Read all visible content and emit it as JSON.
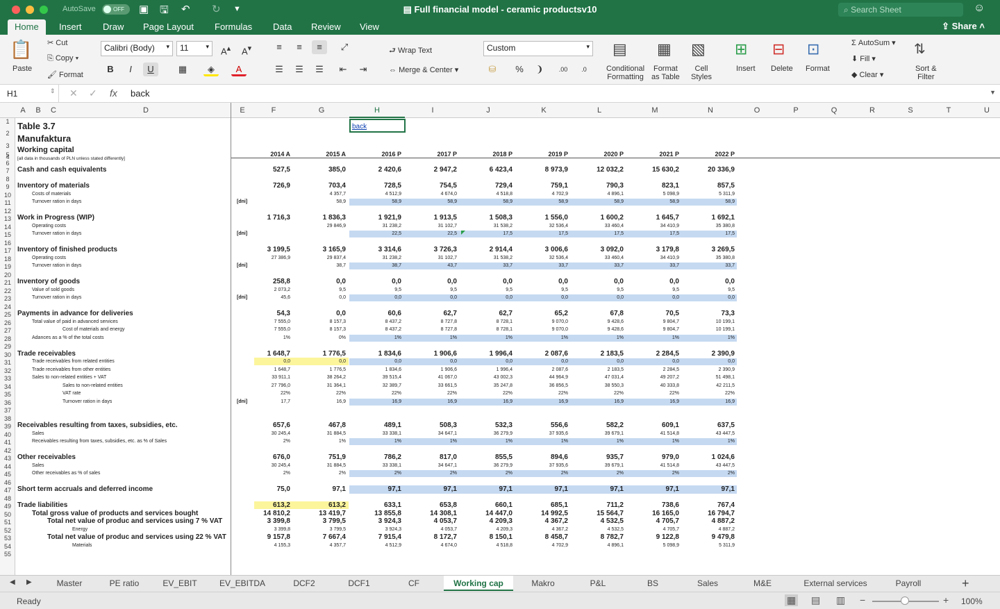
{
  "window": {
    "autosave": "AutoSave",
    "autosave_state": "OFF",
    "title": "Full financial model - ceramic productsv10",
    "search_placeholder": "Search Sheet",
    "share": "Share"
  },
  "ribbon_tabs": [
    "Home",
    "Insert",
    "Draw",
    "Page Layout",
    "Formulas",
    "Data",
    "Review",
    "View"
  ],
  "ribbon": {
    "paste": "Paste",
    "cut": "Cut",
    "copy": "Copy",
    "format_painter": "Format",
    "font_name": "Calibri (Body)",
    "font_size": "11",
    "wrap_text": "Wrap Text",
    "merge_center": "Merge & Center",
    "number_format": "Custom",
    "conditional_formatting": "Conditional\nFormatting",
    "format_as_table": "Format\nas Table",
    "cell_styles": "Cell\nStyles",
    "insert": "Insert",
    "delete": "Delete",
    "format": "Format",
    "autosum": "AutoSum",
    "fill": "Fill",
    "clear": "Clear",
    "sort_filter": "Sort &\nFilter"
  },
  "formula": {
    "cell_ref": "H1",
    "content": "back"
  },
  "columns": [
    "A",
    "B",
    "C",
    "D",
    "E",
    "F",
    "G",
    "H",
    "I",
    "J",
    "K",
    "L",
    "M",
    "N",
    "O",
    "P",
    "Q",
    "R",
    "S",
    "T",
    "U"
  ],
  "sheet": {
    "title": "Table 3.7",
    "company": "Manufaktura",
    "subtitle": "Working capital",
    "note": "[all data in thousands of PLN unless stated differently]",
    "back_link": "back",
    "years": [
      "2014 A",
      "2015 A",
      "2016 P",
      "2017 P",
      "2018 P",
      "2019 P",
      "2020 P",
      "2021 P",
      "2022 P"
    ],
    "rows": [
      {
        "r": 7,
        "label": "Cash and cash equivalents",
        "bold": true,
        "v": [
          "527,5",
          "385,0",
          "2 420,6",
          "2 947,2",
          "6 423,4",
          "8 973,9",
          "12 032,2",
          "15 630,2",
          "20 336,9"
        ]
      },
      {
        "r": 9,
        "label": "Inventory of materials",
        "bold": true,
        "v": [
          "726,9",
          "703,4",
          "728,5",
          "754,5",
          "729,4",
          "759,1",
          "790,3",
          "823,1",
          "857,5"
        ]
      },
      {
        "r": 10,
        "label": "Costs of materials",
        "indent": 1,
        "v": [
          "",
          "4 357,7",
          "4 512,9",
          "4 674,0",
          "4 518,8",
          "4 702,9",
          "4 896,1",
          "5 098,9",
          "5 311,9"
        ]
      },
      {
        "r": 11,
        "label": "Turnover ration in days",
        "indent": 1,
        "unit": "[dni]",
        "band": true,
        "v": [
          "",
          "58,9",
          "58,9",
          "58,9",
          "58,9",
          "58,9",
          "58,9",
          "58,9",
          "58,9"
        ]
      },
      {
        "r": 13,
        "label": "Work in Progress (WIP)",
        "bold": true,
        "v": [
          "1 716,3",
          "1 836,3",
          "1 921,9",
          "1 913,5",
          "1 508,3",
          "1 556,0",
          "1 600,2",
          "1 645,7",
          "1 692,1"
        ]
      },
      {
        "r": 14,
        "label": "Operating costs",
        "indent": 1,
        "v": [
          "",
          "29 846,9",
          "31 238,2",
          "31 102,7",
          "31 538,2",
          "32 536,4",
          "33 460,4",
          "34 410,9",
          "35 380,8"
        ]
      },
      {
        "r": 15,
        "label": "Turnover ration in days",
        "indent": 1,
        "unit": "[dni]",
        "band": true,
        "v": [
          "",
          "",
          "22,5",
          "22,5",
          "17,5",
          "17,5",
          "17,5",
          "17,5",
          "17,5"
        ]
      },
      {
        "r": 17,
        "label": "Inventory of finished products",
        "bold": true,
        "v": [
          "3 199,5",
          "3 165,9",
          "3 314,6",
          "3 726,3",
          "2 914,4",
          "3 006,6",
          "3 092,0",
          "3 179,8",
          "3 269,5"
        ]
      },
      {
        "r": 18,
        "label": "Operating costs",
        "indent": 1,
        "v": [
          "27 386,9",
          "29 837,4",
          "31 238,2",
          "31 102,7",
          "31 538,2",
          "32 536,4",
          "33 460,4",
          "34 410,9",
          "35 380,8"
        ]
      },
      {
        "r": 19,
        "label": "Turnover ration in days",
        "indent": 1,
        "unit": "[dni]",
        "band": true,
        "v": [
          "",
          "38,7",
          "38,7",
          "43,7",
          "33,7",
          "33,7",
          "33,7",
          "33,7",
          "33,7"
        ]
      },
      {
        "r": 21,
        "label": "Inventory of goods",
        "bold": true,
        "v": [
          "258,8",
          "0,0",
          "0,0",
          "0,0",
          "0,0",
          "0,0",
          "0,0",
          "0,0",
          "0,0"
        ]
      },
      {
        "r": 22,
        "label": "Value of sold goods",
        "indent": 1,
        "v": [
          "2 073,2",
          "9,5",
          "9,5",
          "9,5",
          "9,5",
          "9,5",
          "9,5",
          "9,5",
          "9,5"
        ]
      },
      {
        "r": 23,
        "label": "Turnover ration in days",
        "indent": 1,
        "unit": "[dni]",
        "band": true,
        "v": [
          "45,6",
          "0,0",
          "0,0",
          "0,0",
          "0,0",
          "0,0",
          "0,0",
          "0,0",
          "0,0"
        ]
      },
      {
        "r": 25,
        "label": "Payments in advance for deliveries",
        "bold": true,
        "v": [
          "54,3",
          "0,0",
          "60,6",
          "62,7",
          "62,7",
          "65,2",
          "67,8",
          "70,5",
          "73,3"
        ]
      },
      {
        "r": 26,
        "label": "Total value of paid in advanced services",
        "indent": 1,
        "v": [
          "7 555,0",
          "8 157,3",
          "8 437,2",
          "8 727,8",
          "8 728,1",
          "9 070,0",
          "9 428,6",
          "9 804,7",
          "10 199,1"
        ]
      },
      {
        "r": 27,
        "label": "Cost of materials and energy",
        "indent": 2,
        "v": [
          "7 555,0",
          "8 157,3",
          "8 437,2",
          "8 727,8",
          "8 728,1",
          "9 070,0",
          "9 428,6",
          "9 804,7",
          "10 199,1"
        ]
      },
      {
        "r": 28,
        "label": "Adances as a % of the total costs",
        "indent": 1,
        "band": true,
        "v": [
          "1%",
          "0%",
          "1%",
          "1%",
          "1%",
          "1%",
          "1%",
          "1%",
          "1%"
        ]
      },
      {
        "r": 30,
        "label": "Trade receivables",
        "bold": true,
        "v": [
          "1 648,7",
          "1 776,5",
          "1 834,6",
          "1 906,6",
          "1 996,4",
          "2 087,6",
          "2 183,5",
          "2 284,5",
          "2 390,9"
        ]
      },
      {
        "r": 31,
        "label": "Trade receivables from related entities",
        "indent": 1,
        "band": true,
        "yellow": true,
        "v": [
          "0,0",
          "0,0",
          "0,0",
          "0,0",
          "0,0",
          "0,0",
          "0,0",
          "0,0",
          "0,0"
        ]
      },
      {
        "r": 32,
        "label": "Trade receivables from other entities",
        "indent": 1,
        "v": [
          "1 648,7",
          "1 776,5",
          "1 834,6",
          "1 906,6",
          "1 996,4",
          "2 087,6",
          "2 183,5",
          "2 284,5",
          "2 390,9"
        ]
      },
      {
        "r": 33,
        "label": "Sales to non-related entities + VAT",
        "indent": 1,
        "v": [
          "33 911,1",
          "38 264,2",
          "39 515,4",
          "41 067,0",
          "43 002,3",
          "44 964,9",
          "47 031,4",
          "49 207,2",
          "51 498,1"
        ]
      },
      {
        "r": 34,
        "label": "Sales to non-related entities",
        "indent": 2,
        "v": [
          "27 796,0",
          "31 364,1",
          "32 389,7",
          "33 661,5",
          "35 247,8",
          "36 856,5",
          "38 550,3",
          "40 333,8",
          "42 211,5"
        ]
      },
      {
        "r": 35,
        "label": "VAT rate",
        "indent": 2,
        "v": [
          "22%",
          "22%",
          "22%",
          "22%",
          "22%",
          "22%",
          "22%",
          "22%",
          "22%"
        ]
      },
      {
        "r": 36,
        "label": "Turnover ration in days",
        "indent": 2,
        "unit": "[dni]",
        "band": true,
        "v": [
          "17,7",
          "16,9",
          "16,9",
          "16,9",
          "16,9",
          "16,9",
          "16,9",
          "16,9",
          "16,9"
        ]
      },
      {
        "r": 39,
        "label": "Receivables resulting from taxes, subsidies, etc.",
        "bold": true,
        "v": [
          "657,6",
          "467,8",
          "489,1",
          "508,3",
          "532,3",
          "556,6",
          "582,2",
          "609,1",
          "637,5"
        ]
      },
      {
        "r": 40,
        "label": "Sales",
        "indent": 1,
        "v": [
          "30 245,4",
          "31 884,5",
          "33 338,1",
          "34 647,1",
          "36 279,9",
          "37 935,6",
          "39 679,1",
          "41 514,8",
          "43 447,5"
        ]
      },
      {
        "r": 41,
        "label": "Receivables resulting from taxes, subsidies, etc. as % of Sales",
        "indent": 1,
        "band": true,
        "v": [
          "2%",
          "1%",
          "1%",
          "1%",
          "1%",
          "1%",
          "1%",
          "1%",
          "1%"
        ]
      },
      {
        "r": 43,
        "label": "Other receivables",
        "bold": true,
        "v": [
          "676,0",
          "751,9",
          "786,2",
          "817,0",
          "855,5",
          "894,6",
          "935,7",
          "979,0",
          "1 024,6"
        ]
      },
      {
        "r": 44,
        "label": "Sales",
        "indent": 1,
        "v": [
          "30 245,4",
          "31 884,5",
          "33 338,1",
          "34 647,1",
          "36 279,9",
          "37 935,6",
          "39 679,1",
          "41 514,8",
          "43 447,5"
        ]
      },
      {
        "r": 45,
        "label": "Other receivables as % of sales",
        "indent": 1,
        "band": true,
        "v": [
          "2%",
          "2%",
          "2%",
          "2%",
          "2%",
          "2%",
          "2%",
          "2%",
          "2%"
        ]
      },
      {
        "r": 47,
        "label": "Short term accruals and deferred income",
        "bold": true,
        "bigband": true,
        "v": [
          "75,0",
          "97,1",
          "97,1",
          "97,1",
          "97,1",
          "97,1",
          "97,1",
          "97,1",
          "97,1"
        ]
      },
      {
        "r": 49,
        "label": "Trade liabilities",
        "bold": true,
        "yellow": true,
        "v": [
          "613,2",
          "613,2",
          "633,1",
          "653,8",
          "660,1",
          "685,1",
          "711,2",
          "738,6",
          "767,4"
        ]
      },
      {
        "r": 50,
        "label": "Total gross value of products and services bought",
        "bold": true,
        "indent": 1,
        "v": [
          "14 810,2",
          "13 419,7",
          "13 855,8",
          "14 308,1",
          "14 447,0",
          "14 992,5",
          "15 564,7",
          "16 165,0",
          "16 794,7"
        ]
      },
      {
        "r": 51,
        "label": "Total net value of produc and services using 7 % VAT",
        "bold": true,
        "indent": 2,
        "v": [
          "3 399,8",
          "3 799,5",
          "3 924,3",
          "4 053,7",
          "4 209,3",
          "4 367,2",
          "4 532,5",
          "4 705,7",
          "4 887,2"
        ]
      },
      {
        "r": 52,
        "label": "Energy",
        "indent": 3,
        "v": [
          "3 399,8",
          "3 799,5",
          "3 924,3",
          "4 053,7",
          "4 209,3",
          "4 367,2",
          "4 532,5",
          "4 705,7",
          "4 887,2"
        ]
      },
      {
        "r": 53,
        "label": "Total net value of produc and services using 22 % VAT",
        "bold": true,
        "indent": 2,
        "v": [
          "9 157,8",
          "7 667,4",
          "7 915,4",
          "8 172,7",
          "8 150,1",
          "8 458,7",
          "8 782,7",
          "9 122,8",
          "9 479,8"
        ]
      },
      {
        "r": 54,
        "label": "Materials",
        "indent": 3,
        "v": [
          "4 155,3",
          "4 357,7",
          "4 512,9",
          "4 674,0",
          "4 518,8",
          "4 702,9",
          "4 896,1",
          "5 098,9",
          "5 311,9"
        ]
      }
    ]
  },
  "sheet_tabs": [
    "Master",
    "PE ratio",
    "EV_EBIT",
    "EV_EBITDA",
    "DCF2",
    "DCF1",
    "CF",
    "Working cap",
    "Makro",
    "P&L",
    "BS",
    "Sales",
    "M&E",
    "External services",
    "Payroll"
  ],
  "active_tab": "Working cap",
  "status": {
    "ready": "Ready",
    "zoom": "100%"
  }
}
